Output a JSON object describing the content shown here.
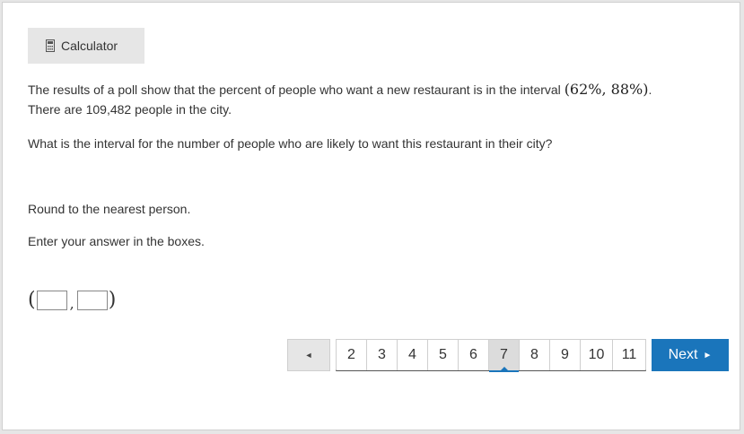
{
  "toolbar": {
    "calculator_label": "Calculator",
    "calculator_icon": "calculator-icon"
  },
  "question": {
    "line1_text": "The results of a poll show that the percent of people who want a new restaurant is in the interval ",
    "interval_math": "(62%, 88%)",
    "line1_end": ".",
    "line2_text": "There are 109,482 people in the city.",
    "prompt": "What is the interval for the number of people who are likely to want this restaurant in their city?",
    "rounding": "Round to the nearest person.",
    "instruction": "Enter your answer in the boxes."
  },
  "answer": {
    "open_paren": "(",
    "comma": ",",
    "close_paren": ")",
    "lower_value": "",
    "upper_value": ""
  },
  "pagination": {
    "prev_label": "◄",
    "pages": [
      "2",
      "3",
      "4",
      "5",
      "6",
      "7",
      "8",
      "9",
      "10",
      "11"
    ],
    "current_page": "7",
    "next_label": "Next",
    "next_icon": "►"
  },
  "colors": {
    "accent": "#1a75bb",
    "button_gray": "#e6e6e6",
    "text": "#333333"
  }
}
